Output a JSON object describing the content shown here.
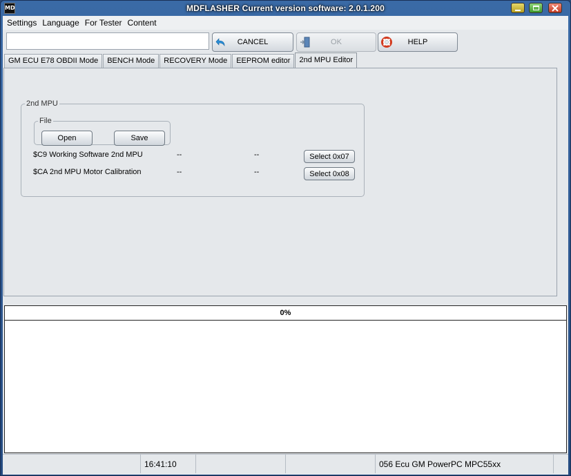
{
  "window": {
    "title": "MDFLASHER  Current version software: 2.0.1.200",
    "app_icon_text": "MD"
  },
  "menu": [
    "Settings",
    "Language",
    "For Tester",
    "Content"
  ],
  "toolbar": {
    "input_value": "",
    "cancel_label": "CANCEL",
    "ok_label": "OK",
    "help_label": "HELP"
  },
  "tabs": [
    {
      "label": "GM ECU E78 OBDII Mode",
      "active": false
    },
    {
      "label": "BENCH Mode",
      "active": false
    },
    {
      "label": "RECOVERY Mode",
      "active": false
    },
    {
      "label": "EEPROM editor",
      "active": false
    },
    {
      "label": "2nd MPU Editor",
      "active": true
    }
  ],
  "mpu_panel": {
    "group_label": "2nd MPU",
    "file_group_label": "File",
    "open_label": "Open",
    "save_label": "Save",
    "rows": [
      {
        "label": "$C9 Working Software 2nd MPU",
        "value1": "--",
        "value2": "--",
        "button": "Select 0x07"
      },
      {
        "label": "$CA 2nd MPU Motor Calibration",
        "value1": "--",
        "value2": "--",
        "button": "Select 0x08"
      }
    ]
  },
  "progress": {
    "text": "0%",
    "value": 0
  },
  "statusbar": [
    "",
    "16:41:10",
    "",
    "",
    "056 Ecu GM PowerPC MPC55xx",
    ""
  ],
  "colors": {
    "accent_blue": "#2f5e9c",
    "help_red": "#d23a1e"
  }
}
